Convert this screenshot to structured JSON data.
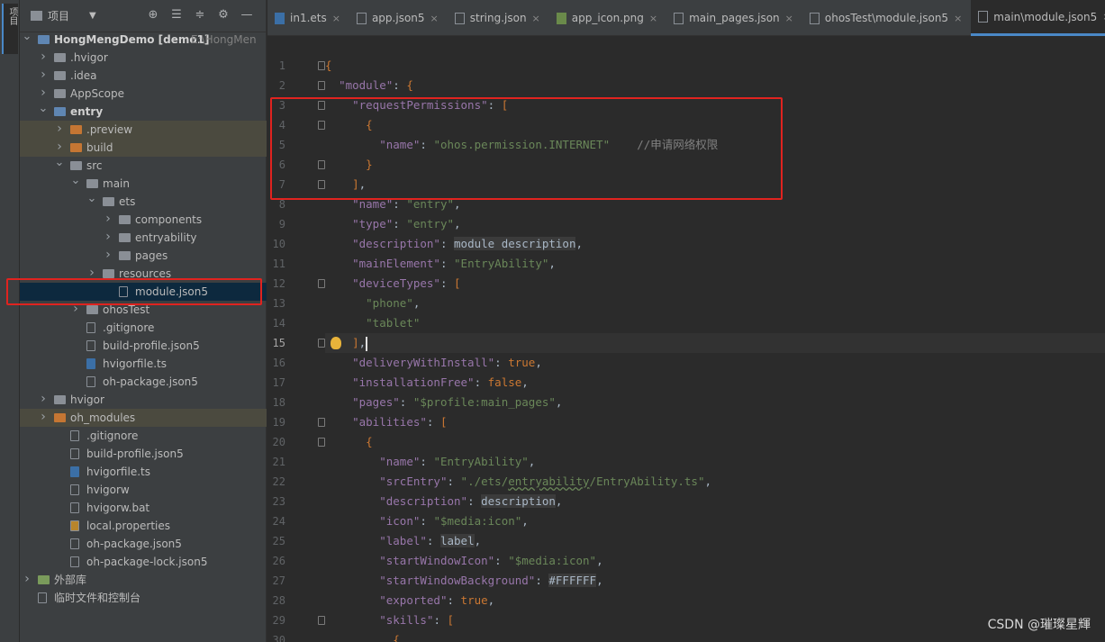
{
  "side_stripe": {
    "label": "项目"
  },
  "project_panel": {
    "title": "项目",
    "tree": [
      {
        "label": "HongMengDemo [demo1]",
        "extra": "E:\\HongMen",
        "depth": 0,
        "twisty": "open",
        "icon": "module-folder",
        "bold": true
      },
      {
        "label": ".hvigor",
        "depth": 1,
        "twisty": "closed",
        "icon": "folder"
      },
      {
        "label": ".idea",
        "depth": 1,
        "twisty": "closed",
        "icon": "folder"
      },
      {
        "label": "AppScope",
        "depth": 1,
        "twisty": "closed",
        "icon": "folder"
      },
      {
        "label": "entry",
        "depth": 1,
        "twisty": "open",
        "icon": "module-folder",
        "bold": true
      },
      {
        "label": ".preview",
        "depth": 2,
        "twisty": "closed",
        "icon": "folder-orange",
        "highlight": true
      },
      {
        "label": "build",
        "depth": 2,
        "twisty": "closed",
        "icon": "folder-orange",
        "highlight": true
      },
      {
        "label": "src",
        "depth": 2,
        "twisty": "open",
        "icon": "folder"
      },
      {
        "label": "main",
        "depth": 3,
        "twisty": "open",
        "icon": "folder"
      },
      {
        "label": "ets",
        "depth": 4,
        "twisty": "open",
        "icon": "folder"
      },
      {
        "label": "components",
        "depth": 5,
        "twisty": "closed",
        "icon": "folder"
      },
      {
        "label": "entryability",
        "depth": 5,
        "twisty": "closed",
        "icon": "folder"
      },
      {
        "label": "pages",
        "depth": 5,
        "twisty": "closed",
        "icon": "folder"
      },
      {
        "label": "resources",
        "depth": 4,
        "twisty": "closed",
        "icon": "folder"
      },
      {
        "label": "module.json5",
        "depth": 5,
        "twisty": "none",
        "icon": "json-file",
        "selected": true
      },
      {
        "label": "ohosTest",
        "depth": 3,
        "twisty": "closed",
        "icon": "folder"
      },
      {
        "label": ".gitignore",
        "depth": 3,
        "twisty": "none",
        "icon": "file"
      },
      {
        "label": "build-profile.json5",
        "depth": 3,
        "twisty": "none",
        "icon": "json-file"
      },
      {
        "label": "hvigorfile.ts",
        "depth": 3,
        "twisty": "none",
        "icon": "ts-file"
      },
      {
        "label": "oh-package.json5",
        "depth": 3,
        "twisty": "none",
        "icon": "json-file"
      },
      {
        "label": "hvigor",
        "depth": 1,
        "twisty": "closed",
        "icon": "folder"
      },
      {
        "label": "oh_modules",
        "depth": 1,
        "twisty": "closed",
        "icon": "folder-orange",
        "highlight": true
      },
      {
        "label": ".gitignore",
        "depth": 2,
        "twisty": "none",
        "icon": "file"
      },
      {
        "label": "build-profile.json5",
        "depth": 2,
        "twisty": "none",
        "icon": "json-file"
      },
      {
        "label": "hvigorfile.ts",
        "depth": 2,
        "twisty": "none",
        "icon": "ts-file"
      },
      {
        "label": "hvigorw",
        "depth": 2,
        "twisty": "none",
        "icon": "file"
      },
      {
        "label": "hvigorw.bat",
        "depth": 2,
        "twisty": "none",
        "icon": "file"
      },
      {
        "label": "local.properties",
        "depth": 2,
        "twisty": "none",
        "icon": "properties-file"
      },
      {
        "label": "oh-package.json5",
        "depth": 2,
        "twisty": "none",
        "icon": "json-file"
      },
      {
        "label": "oh-package-lock.json5",
        "depth": 2,
        "twisty": "none",
        "icon": "json-file"
      },
      {
        "label": "外部库",
        "depth": 0,
        "twisty": "closed",
        "icon": "library"
      },
      {
        "label": "临时文件和控制台",
        "depth": 0,
        "twisty": "none",
        "icon": "scratch"
      }
    ]
  },
  "editor_tabs": [
    {
      "label": "in1.ets",
      "icon": "ts"
    },
    {
      "label": "app.json5",
      "icon": "json"
    },
    {
      "label": "string.json",
      "icon": "json"
    },
    {
      "label": "app_icon.png",
      "icon": "img"
    },
    {
      "label": "main_pages.json",
      "icon": "json"
    },
    {
      "label": "ohosTest\\module.json5",
      "icon": "json"
    },
    {
      "label": "main\\module.json5",
      "icon": "json",
      "active": true
    }
  ],
  "code_lines": [
    {
      "n": "1",
      "html": "<span class='p'>{</span>"
    },
    {
      "n": "2",
      "html": "  <span class='k'>\"module\"</span>: <span class='p'>{</span>"
    },
    {
      "n": "3",
      "html": "    <span class='k'>\"requestPermissions\"</span>: <span class='p'>[</span>"
    },
    {
      "n": "4",
      "html": "      <span class='p'>{</span>"
    },
    {
      "n": "5",
      "html": "        <span class='k'>\"name\"</span>: <span class='s'>\"ohos.permission.INTERNET\"</span>    <span class='c'>//申请网络权限</span>"
    },
    {
      "n": "6",
      "html": "      <span class='p'>}</span>"
    },
    {
      "n": "7",
      "html": "    <span class='p'>]</span>,"
    },
    {
      "n": "8",
      "html": "    <span class='k'>\"name\"</span>: <span class='s'>\"entry\"</span>,"
    },
    {
      "n": "9",
      "html": "    <span class='k'>\"type\"</span>: <span class='s'>\"entry\"</span>,"
    },
    {
      "n": "10",
      "html": "    <span class='k'>\"description\"</span>: <span class='bg'>module description</span>,"
    },
    {
      "n": "11",
      "html": "    <span class='k'>\"mainElement\"</span>: <span class='s'>\"EntryAbility\"</span>,"
    },
    {
      "n": "12",
      "html": "    <span class='k'>\"deviceTypes\"</span>: <span class='p'>[</span>"
    },
    {
      "n": "13",
      "html": "      <span class='s'>\"phone\"</span>,"
    },
    {
      "n": "14",
      "html": "      <span class='s'>\"tablet\"</span>"
    },
    {
      "n": "15",
      "html": "    <span class='p'>]</span>,<span class='caret'></span>",
      "current": true
    },
    {
      "n": "16",
      "html": "    <span class='k'>\"deliveryWithInstall\"</span>: <span class='kw'>true</span>,"
    },
    {
      "n": "17",
      "html": "    <span class='k'>\"installationFree\"</span>: <span class='kw'>false</span>,"
    },
    {
      "n": "18",
      "html": "    <span class='k'>\"pages\"</span>: <span class='s'>\"$profile:main_pages\"</span>,"
    },
    {
      "n": "19",
      "html": "    <span class='k'>\"abilities\"</span>: <span class='p'>[</span>"
    },
    {
      "n": "20",
      "html": "      <span class='p'>{</span>"
    },
    {
      "n": "21",
      "html": "        <span class='k'>\"name\"</span>: <span class='s'>\"EntryAbility\"</span>,"
    },
    {
      "n": "22",
      "html": "        <span class='k'>\"srcEntry\"</span>: <span class='s'>\"./ets/<span class='under'>entryability</span>/EntryAbility.ts\"</span>,"
    },
    {
      "n": "23",
      "html": "        <span class='k'>\"description\"</span>: <span class='bg'>description</span>,"
    },
    {
      "n": "24",
      "html": "        <span class='k'>\"icon\"</span>: <span class='s'>\"$media:icon\"</span>,"
    },
    {
      "n": "25",
      "html": "        <span class='k'>\"label\"</span>: <span class='bg'>label</span>,"
    },
    {
      "n": "26",
      "html": "        <span class='k'>\"startWindowIcon\"</span>: <span class='s'>\"$media:icon\"</span>,"
    },
    {
      "n": "27",
      "html": "        <span class='k'>\"startWindowBackground\"</span>: <span class='bg'>#FFFFFF</span>,"
    },
    {
      "n": "28",
      "html": "        <span class='k'>\"exported\"</span>: <span class='kw'>true</span>,"
    },
    {
      "n": "29",
      "html": "        <span class='k'>\"skills\"</span>: <span class='p'>[</span>"
    },
    {
      "n": "30",
      "html": "          <span class='p'>{</span>"
    }
  ],
  "watermark": "CSDN @璀璨星輝",
  "colors": {
    "highlight_box": "#e0231f",
    "accent": "#4a88c7"
  }
}
